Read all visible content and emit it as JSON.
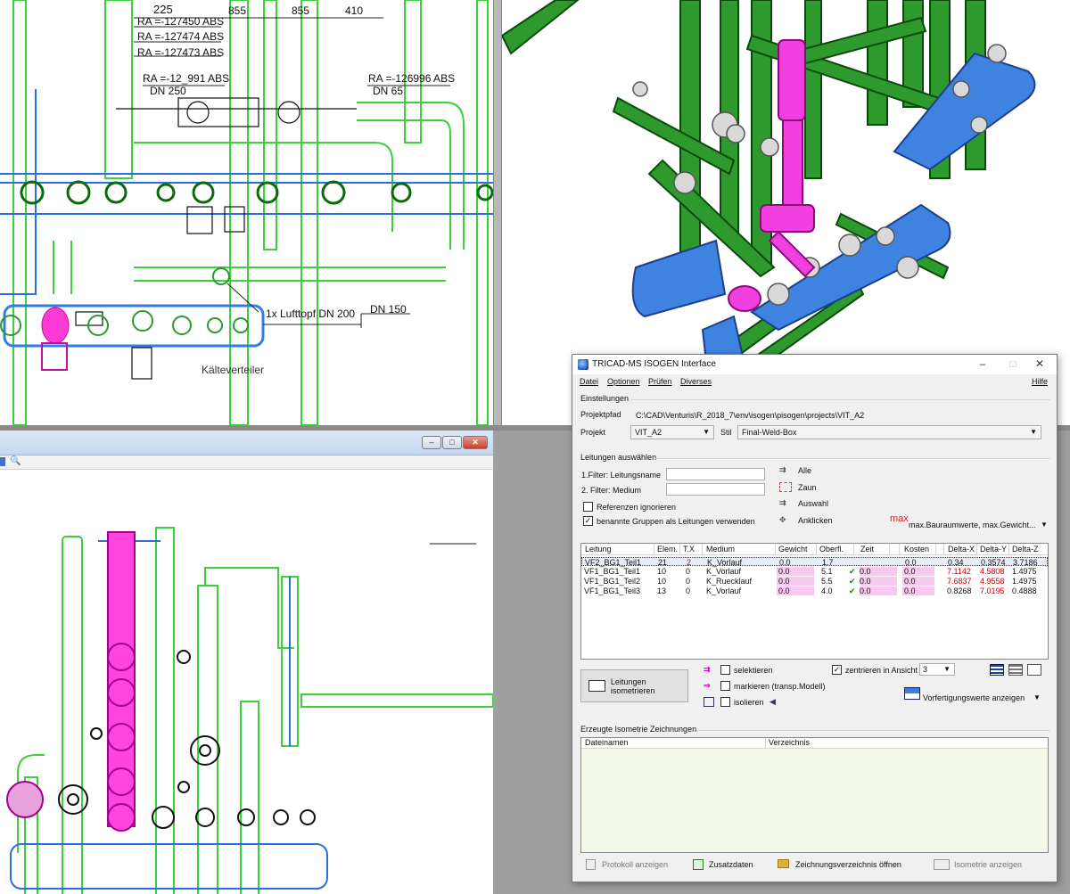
{
  "top_left": {
    "dims": [
      "225",
      "855",
      "855",
      "410"
    ],
    "ra_labels": [
      "RA =-127450 ABS",
      "RA =-127474 ABS",
      "RA =-127473 ABS",
      "RA =-12_991 ABS",
      "RA =-126996 ABS"
    ],
    "dn_labels": [
      "DN 250",
      "DN 65",
      "DN 150"
    ],
    "lufttopf": "1x Lufttopf DN 200",
    "kaelteverteiler": "Kälteverteiler"
  },
  "window_bl": {
    "buttons": [
      "–",
      "□",
      "✕"
    ]
  },
  "dialog": {
    "title": "TRICAD-MS ISOGEN Interface",
    "controls": [
      "–",
      "□",
      "✕"
    ],
    "menu": [
      "Datei",
      "Optionen",
      "Prüfen",
      "Diverses"
    ],
    "help": "Hilfe",
    "settings": {
      "section": "Einstellungen",
      "projektpfad_label": "Projektpfad",
      "projektpfad_value": "C:\\CAD\\Venturis\\R_2018_7\\env\\isogen\\pisogen\\projects\\VIT_A2",
      "projekt_label": "Projekt",
      "projekt_value": "VIT_A2",
      "stil_label": "Stil",
      "stil_value": "Final-Weld-Box"
    },
    "select": {
      "section": "Leitungen auswählen",
      "filter1_label": "1.Filter: Leitungsname",
      "filter2_label": "2. Filter: Medium",
      "filter1_value": "",
      "filter2_value": "",
      "ref_ignore": "Referenzen ignorieren",
      "named_groups": "benannte Gruppen als Leitungen verwenden",
      "alle": "Alle",
      "zaun": "Zaun",
      "auswahl": "Auswahl",
      "anklicken": "Anklicken",
      "max_label": "max.Bauraumwerte, max.Gewicht...",
      "max_icon_text": "max"
    },
    "table": {
      "headers": [
        "Leitung",
        "Elem.",
        "T.X",
        "Medium",
        "Gewicht",
        "Oberfl.",
        "Zeit",
        "Kosten",
        "Delta-X",
        "Delta-Y",
        "Delta-Z"
      ],
      "rows": [
        {
          "leitung": "VF2_BG1_Teil1",
          "elem": "21",
          "tx": "2",
          "medium": "K_Vorlauf",
          "gewicht": "0.0",
          "oberfl": "1.7",
          "zeit": "",
          "kosten": "0.0",
          "dx": "0.34",
          "dy": "0.3574",
          "dz": "3.7186"
        },
        {
          "leitung": "VF1_BG1_Teil1",
          "elem": "10",
          "tx": "0",
          "medium": "K_Vorlauf",
          "gewicht": "0.0",
          "oberfl": "5.1",
          "zeit": "0.0",
          "kosten": "0.0",
          "dx": "7.1142",
          "dy": "4.5808",
          "dz": "1.4975"
        },
        {
          "leitung": "VF1_BG1_Teil2",
          "elem": "10",
          "tx": "0",
          "medium": "K_Ruecklauf",
          "gewicht": "0.0",
          "oberfl": "5.5",
          "zeit": "0.0",
          "kosten": "0.0",
          "dx": "7.6837",
          "dy": "4.9558",
          "dz": "1.4975"
        },
        {
          "leitung": "VF1_BG1_Teil3",
          "elem": "13",
          "tx": "0",
          "medium": "K_Vorlauf",
          "gewicht": "0.0",
          "oberfl": "4.0",
          "zeit": "0.0",
          "kosten": "0.0",
          "dx": "0.8268",
          "dy": "7.0195",
          "dz": "0.4888"
        }
      ]
    },
    "actions": {
      "isometrieren": "Leitungen isometrieren",
      "selektieren": "selektieren",
      "markieren": "markieren (transp.Modell)",
      "isolieren": "isolieren",
      "zentrieren": "zentrieren in Ansicht",
      "ansicht_value": "3",
      "vorfertigung": "Vorfertigungswerte anzeigen"
    },
    "output": {
      "section": "Erzeugte Isometrie Zeichnungen",
      "col_dateinamen": "Dateinamen",
      "col_verzeichnis": "Verzeichnis"
    },
    "bottom": {
      "protokoll": "Protokoll anzeigen",
      "zusatzdaten": "Zusatzdaten",
      "zeichnungsverzeichnis": "Zeichnungsverzeichnis öffnen",
      "isometrie_anzeigen": "Isometrie anzeigen"
    }
  }
}
